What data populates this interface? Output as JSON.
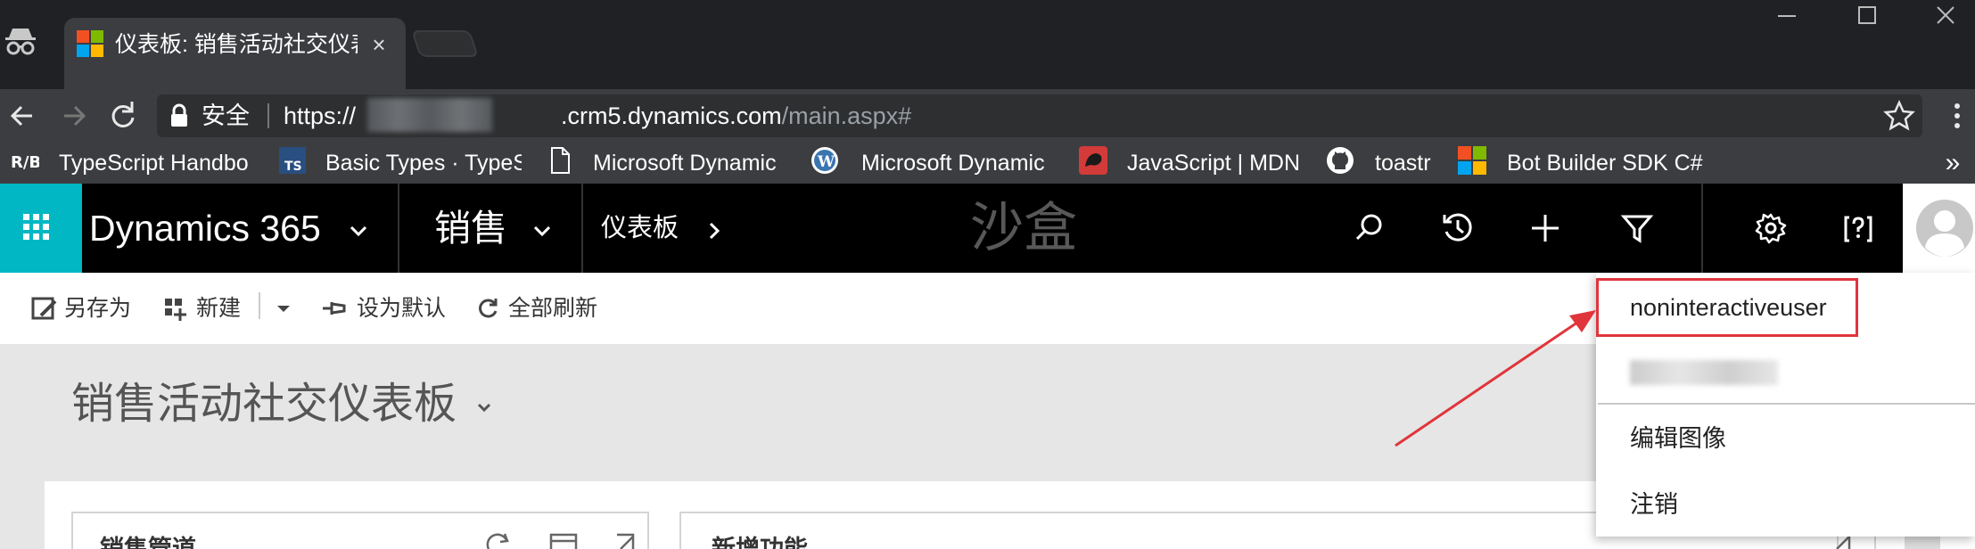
{
  "browser": {
    "tab": {
      "title": "仪表板: 销售活动社交仪表",
      "close": "×"
    },
    "address": {
      "security_label": "安全",
      "url_scheme": "https://",
      "url_host": ".crm5.dynamics.com",
      "url_path": "/main.aspx#"
    },
    "bookmarks": [
      {
        "label": "TypeScript Handbo",
        "icon": "typescript-handbook-icon"
      },
      {
        "label": "Basic Types · TypeS",
        "icon": "typescript-icon"
      },
      {
        "label": "Microsoft Dynamic",
        "icon": "page-icon"
      },
      {
        "label": "Microsoft Dynamic",
        "icon": "wordpress-icon"
      },
      {
        "label": "JavaScript | MDN",
        "icon": "mdn-icon"
      },
      {
        "label": "toastr",
        "icon": "github-icon"
      },
      {
        "label": "Bot Builder SDK C#",
        "icon": "microsoft-icon"
      }
    ],
    "more": "»"
  },
  "dynamics": {
    "brand": "Dynamics 365",
    "app": "销售",
    "breadcrumb": "仪表板",
    "environment": "沙盒",
    "accent_color": "#00b7c3"
  },
  "commands": {
    "save_as": "另存为",
    "new": "新建",
    "set_default": "设为默认",
    "refresh_all": "全部刷新"
  },
  "page": {
    "title": "销售活动社交仪表板",
    "cards": [
      {
        "title": "销售管道"
      },
      {
        "title": "新增功能"
      }
    ]
  },
  "user_menu": {
    "username": "noninteractiveuser",
    "edit_image": "编辑图像",
    "sign_out": "注销",
    "highlight_color": "#e0353b"
  }
}
